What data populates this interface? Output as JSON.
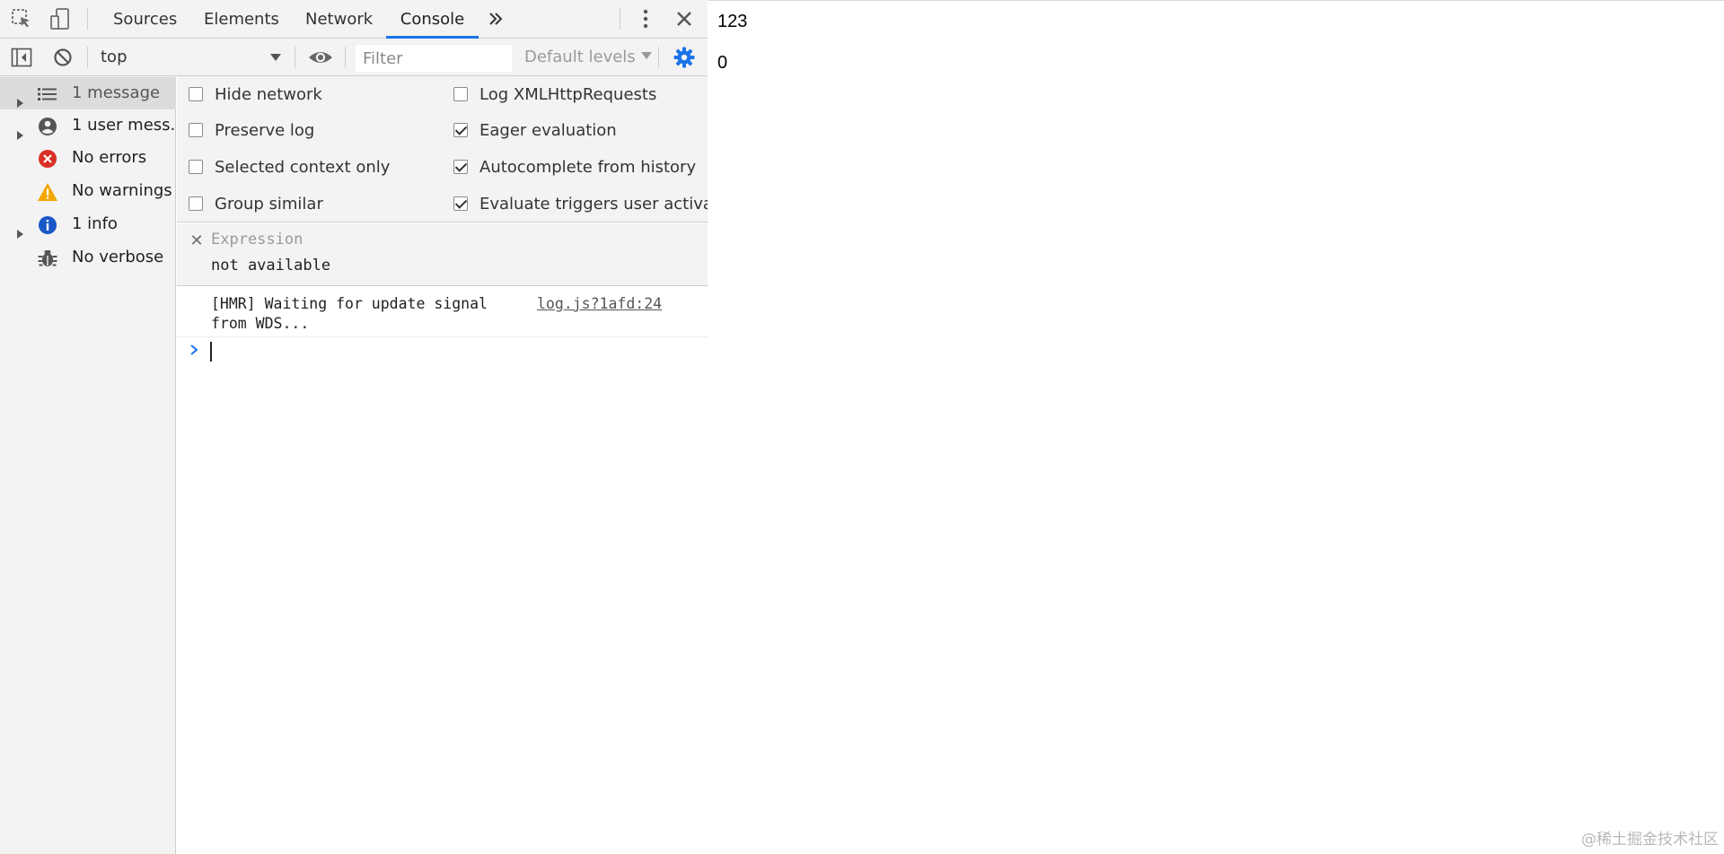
{
  "devtools": {
    "tabs": [
      {
        "label": "Sources",
        "active": false
      },
      {
        "label": "Elements",
        "active": false
      },
      {
        "label": "Network",
        "active": false
      },
      {
        "label": "Console",
        "active": true
      }
    ],
    "toolbar": {
      "context": "top",
      "filter_placeholder": "Filter",
      "levels": "Default levels"
    },
    "sidebar": {
      "items": [
        {
          "label": "1 message",
          "icon": "list-icon",
          "expandable": true,
          "selected": true
        },
        {
          "label": "1 user mess...",
          "icon": "user-icon",
          "expandable": true,
          "selected": false
        },
        {
          "label": "No errors",
          "icon": "error-icon",
          "expandable": false,
          "selected": false
        },
        {
          "label": "No warnings",
          "icon": "warning-icon",
          "expandable": false,
          "selected": false
        },
        {
          "label": "1 info",
          "icon": "info-icon",
          "expandable": true,
          "selected": false
        },
        {
          "label": "No verbose",
          "icon": "bug-icon",
          "expandable": false,
          "selected": false
        }
      ]
    },
    "settings": {
      "left": [
        {
          "label": "Hide network",
          "checked": false
        },
        {
          "label": "Preserve log",
          "checked": false
        },
        {
          "label": "Selected context only",
          "checked": false
        },
        {
          "label": "Group similar",
          "checked": false
        }
      ],
      "right": [
        {
          "label": "Log XMLHttpRequests",
          "checked": false
        },
        {
          "label": "Eager evaluation",
          "checked": true
        },
        {
          "label": "Autocomplete from history",
          "checked": true
        },
        {
          "label": "Evaluate triggers user activatio",
          "checked": true
        }
      ]
    },
    "live_expression": {
      "label": "Expression",
      "value": "not available"
    },
    "messages": [
      {
        "text": "[HMR] Waiting for update signal from WDS...",
        "source": "log.js?1afd:24"
      }
    ],
    "colors": {
      "accent": "#1a73e8",
      "error": "#d93025",
      "warning": "#f2a600",
      "info": "#1a57c7"
    }
  },
  "page": {
    "lines": [
      "123",
      "0"
    ],
    "watermark": "@稀土掘金技术社区"
  }
}
